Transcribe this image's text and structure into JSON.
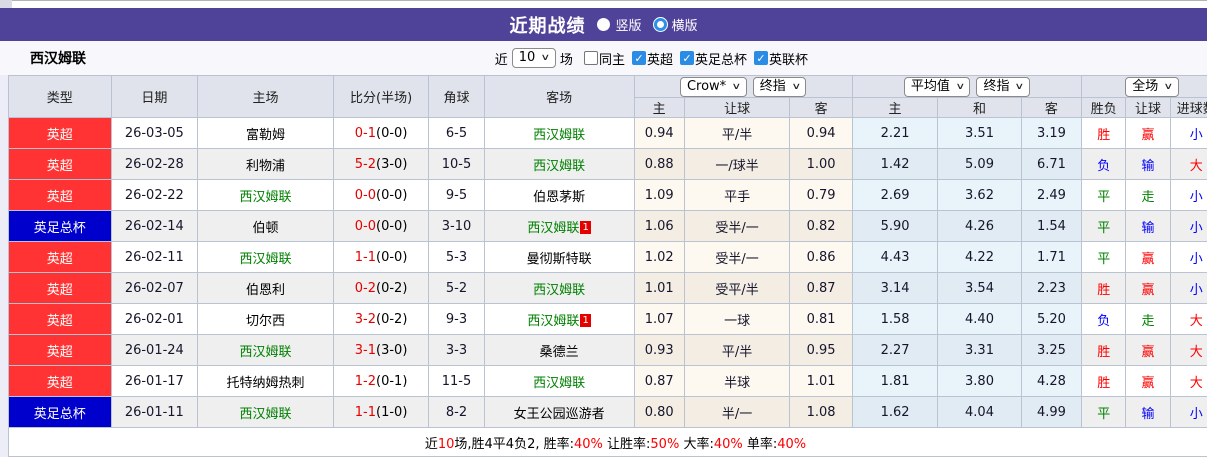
{
  "title_bar": {
    "title": "近期战绩",
    "vertical_label": "竖版",
    "horizontal_label": "横版",
    "selected": "横版"
  },
  "team_bar": {
    "team": "西汉姆联",
    "near_label": "近",
    "match_count": "10",
    "matches_label": "场",
    "checkboxes": [
      {
        "label": "同主",
        "checked": false
      },
      {
        "label": "英超",
        "checked": true
      },
      {
        "label": "英足总杯",
        "checked": true
      },
      {
        "label": "英联杯",
        "checked": true
      }
    ]
  },
  "table": {
    "headers_left": [
      "类型",
      "日期",
      "主场",
      "比分(半场)",
      "角球",
      "客场"
    ],
    "dropdowns": {
      "asia_company": "Crow*",
      "asia_type": "终指",
      "euro_company": "平均值",
      "euro_type": "终指",
      "scope": "全场"
    },
    "sub_headers": [
      "主",
      "让球",
      "客",
      "主",
      "和",
      "客",
      "胜负",
      "让球",
      "进球数"
    ],
    "league_colors": {
      "英超": "#ff3333",
      "英足总杯": "#0000cc"
    },
    "rows": [
      {
        "league": "英超",
        "date": "26-03-05",
        "home": {
          "name": "富勒姆",
          "green": false,
          "badge": ""
        },
        "score_ft": "0-1",
        "score_ht": "(0-0)",
        "corner": "6-5",
        "away": {
          "name": "西汉姆联",
          "green": true,
          "badge": ""
        },
        "asia": [
          "0.94",
          "平/半",
          "0.94"
        ],
        "euro": [
          "2.21",
          "3.51",
          "3.19"
        ],
        "result": [
          {
            "text": "胜",
            "color": "red"
          },
          {
            "text": "赢",
            "color": "red"
          },
          {
            "text": "小",
            "color": "blue"
          }
        ]
      },
      {
        "league": "英超",
        "date": "26-02-28",
        "home": {
          "name": "利物浦",
          "green": false,
          "badge": ""
        },
        "score_ft": "5-2",
        "score_ht": "(3-0)",
        "corner": "10-5",
        "away": {
          "name": "西汉姆联",
          "green": true,
          "badge": ""
        },
        "asia": [
          "0.88",
          "一/球半",
          "1.00"
        ],
        "euro": [
          "1.42",
          "5.09",
          "6.71"
        ],
        "result": [
          {
            "text": "负",
            "color": "blue"
          },
          {
            "text": "输",
            "color": "blue"
          },
          {
            "text": "大",
            "color": "red"
          }
        ]
      },
      {
        "league": "英超",
        "date": "26-02-22",
        "home": {
          "name": "西汉姆联",
          "green": true,
          "badge": ""
        },
        "score_ft": "0-0",
        "score_ht": "(0-0)",
        "corner": "9-5",
        "away": {
          "name": "伯恩茅斯",
          "green": false,
          "badge": ""
        },
        "asia": [
          "1.09",
          "平手",
          "0.79"
        ],
        "euro": [
          "2.69",
          "3.62",
          "2.49"
        ],
        "result": [
          {
            "text": "平",
            "color": "green"
          },
          {
            "text": "走",
            "color": "green"
          },
          {
            "text": "小",
            "color": "blue"
          }
        ]
      },
      {
        "league": "英足总杯",
        "date": "26-02-14",
        "home": {
          "name": "伯顿",
          "green": false,
          "badge": ""
        },
        "score_ft": "0-0",
        "score_ht": "(0-0)",
        "corner": "3-10",
        "away": {
          "name": "西汉姆联",
          "green": true,
          "badge": "1"
        },
        "asia": [
          "1.06",
          "受半/一",
          "0.82"
        ],
        "euro": [
          "5.90",
          "4.26",
          "1.54"
        ],
        "result": [
          {
            "text": "平",
            "color": "green"
          },
          {
            "text": "输",
            "color": "blue"
          },
          {
            "text": "小",
            "color": "blue"
          }
        ]
      },
      {
        "league": "英超",
        "date": "26-02-11",
        "home": {
          "name": "西汉姆联",
          "green": true,
          "badge": ""
        },
        "score_ft": "1-1",
        "score_ht": "(0-0)",
        "corner": "5-3",
        "away": {
          "name": "曼彻斯特联",
          "green": false,
          "badge": ""
        },
        "asia": [
          "1.02",
          "受半/一",
          "0.86"
        ],
        "euro": [
          "4.43",
          "4.22",
          "1.71"
        ],
        "result": [
          {
            "text": "平",
            "color": "green"
          },
          {
            "text": "赢",
            "color": "red"
          },
          {
            "text": "小",
            "color": "blue"
          }
        ]
      },
      {
        "league": "英超",
        "date": "26-02-07",
        "home": {
          "name": "伯恩利",
          "green": false,
          "badge": ""
        },
        "score_ft": "0-2",
        "score_ht": "(0-2)",
        "corner": "5-2",
        "away": {
          "name": "西汉姆联",
          "green": true,
          "badge": ""
        },
        "asia": [
          "1.01",
          "受平/半",
          "0.87"
        ],
        "euro": [
          "3.14",
          "3.54",
          "2.23"
        ],
        "result": [
          {
            "text": "胜",
            "color": "red"
          },
          {
            "text": "赢",
            "color": "red"
          },
          {
            "text": "小",
            "color": "blue"
          }
        ]
      },
      {
        "league": "英超",
        "date": "26-02-01",
        "home": {
          "name": "切尔西",
          "green": false,
          "badge": ""
        },
        "score_ft": "3-2",
        "score_ht": "(0-2)",
        "corner": "9-3",
        "away": {
          "name": "西汉姆联",
          "green": true,
          "badge": "1"
        },
        "asia": [
          "1.07",
          "一球",
          "0.81"
        ],
        "euro": [
          "1.58",
          "4.40",
          "5.20"
        ],
        "result": [
          {
            "text": "负",
            "color": "blue"
          },
          {
            "text": "走",
            "color": "green"
          },
          {
            "text": "大",
            "color": "red"
          }
        ]
      },
      {
        "league": "英超",
        "date": "26-01-24",
        "home": {
          "name": "西汉姆联",
          "green": true,
          "badge": ""
        },
        "score_ft": "3-1",
        "score_ht": "(3-0)",
        "corner": "3-3",
        "away": {
          "name": "桑德兰",
          "green": false,
          "badge": ""
        },
        "asia": [
          "0.93",
          "平/半",
          "0.95"
        ],
        "euro": [
          "2.27",
          "3.31",
          "3.25"
        ],
        "result": [
          {
            "text": "胜",
            "color": "red"
          },
          {
            "text": "赢",
            "color": "red"
          },
          {
            "text": "大",
            "color": "red"
          }
        ]
      },
      {
        "league": "英超",
        "date": "26-01-17",
        "home": {
          "name": "托特纳姆热刺",
          "green": false,
          "badge": ""
        },
        "score_ft": "1-2",
        "score_ht": "(0-1)",
        "corner": "11-5",
        "away": {
          "name": "西汉姆联",
          "green": true,
          "badge": ""
        },
        "asia": [
          "0.87",
          "半球",
          "1.01"
        ],
        "euro": [
          "1.81",
          "3.80",
          "4.28"
        ],
        "result": [
          {
            "text": "胜",
            "color": "red"
          },
          {
            "text": "赢",
            "color": "red"
          },
          {
            "text": "大",
            "color": "red"
          }
        ]
      },
      {
        "league": "英足总杯",
        "date": "26-01-11",
        "home": {
          "name": "西汉姆联",
          "green": true,
          "badge": ""
        },
        "score_ft": "1-1",
        "score_ht": "(1-0)",
        "corner": "8-2",
        "away": {
          "name": "女王公园巡游者",
          "green": false,
          "badge": ""
        },
        "asia": [
          "0.80",
          "半/一",
          "1.08"
        ],
        "euro": [
          "1.62",
          "4.04",
          "4.99"
        ],
        "result": [
          {
            "text": "平",
            "color": "green"
          },
          {
            "text": "输",
            "color": "blue"
          },
          {
            "text": "小",
            "color": "blue"
          }
        ]
      }
    ],
    "summary_parts": [
      {
        "text": "近",
        "red": false
      },
      {
        "text": "10",
        "red": true
      },
      {
        "text": "场,胜4平4负2, 胜率:",
        "red": false
      },
      {
        "text": "40%",
        "red": true
      },
      {
        "text": " 让胜率:",
        "red": false
      },
      {
        "text": "50%",
        "red": true
      },
      {
        "text": " 大率:",
        "red": false
      },
      {
        "text": "40%",
        "red": true
      },
      {
        "text": " 单率:",
        "red": false
      },
      {
        "text": "40%",
        "red": true
      }
    ]
  },
  "colors": {
    "header_bar": "#4f4299",
    "checkbox_blue": "#2b8ce6",
    "win_red": "#fe0000",
    "lose_blue": "#0000fe",
    "draw_green": "#008000",
    "team_green": "#008000",
    "score_red": "#e50000"
  }
}
